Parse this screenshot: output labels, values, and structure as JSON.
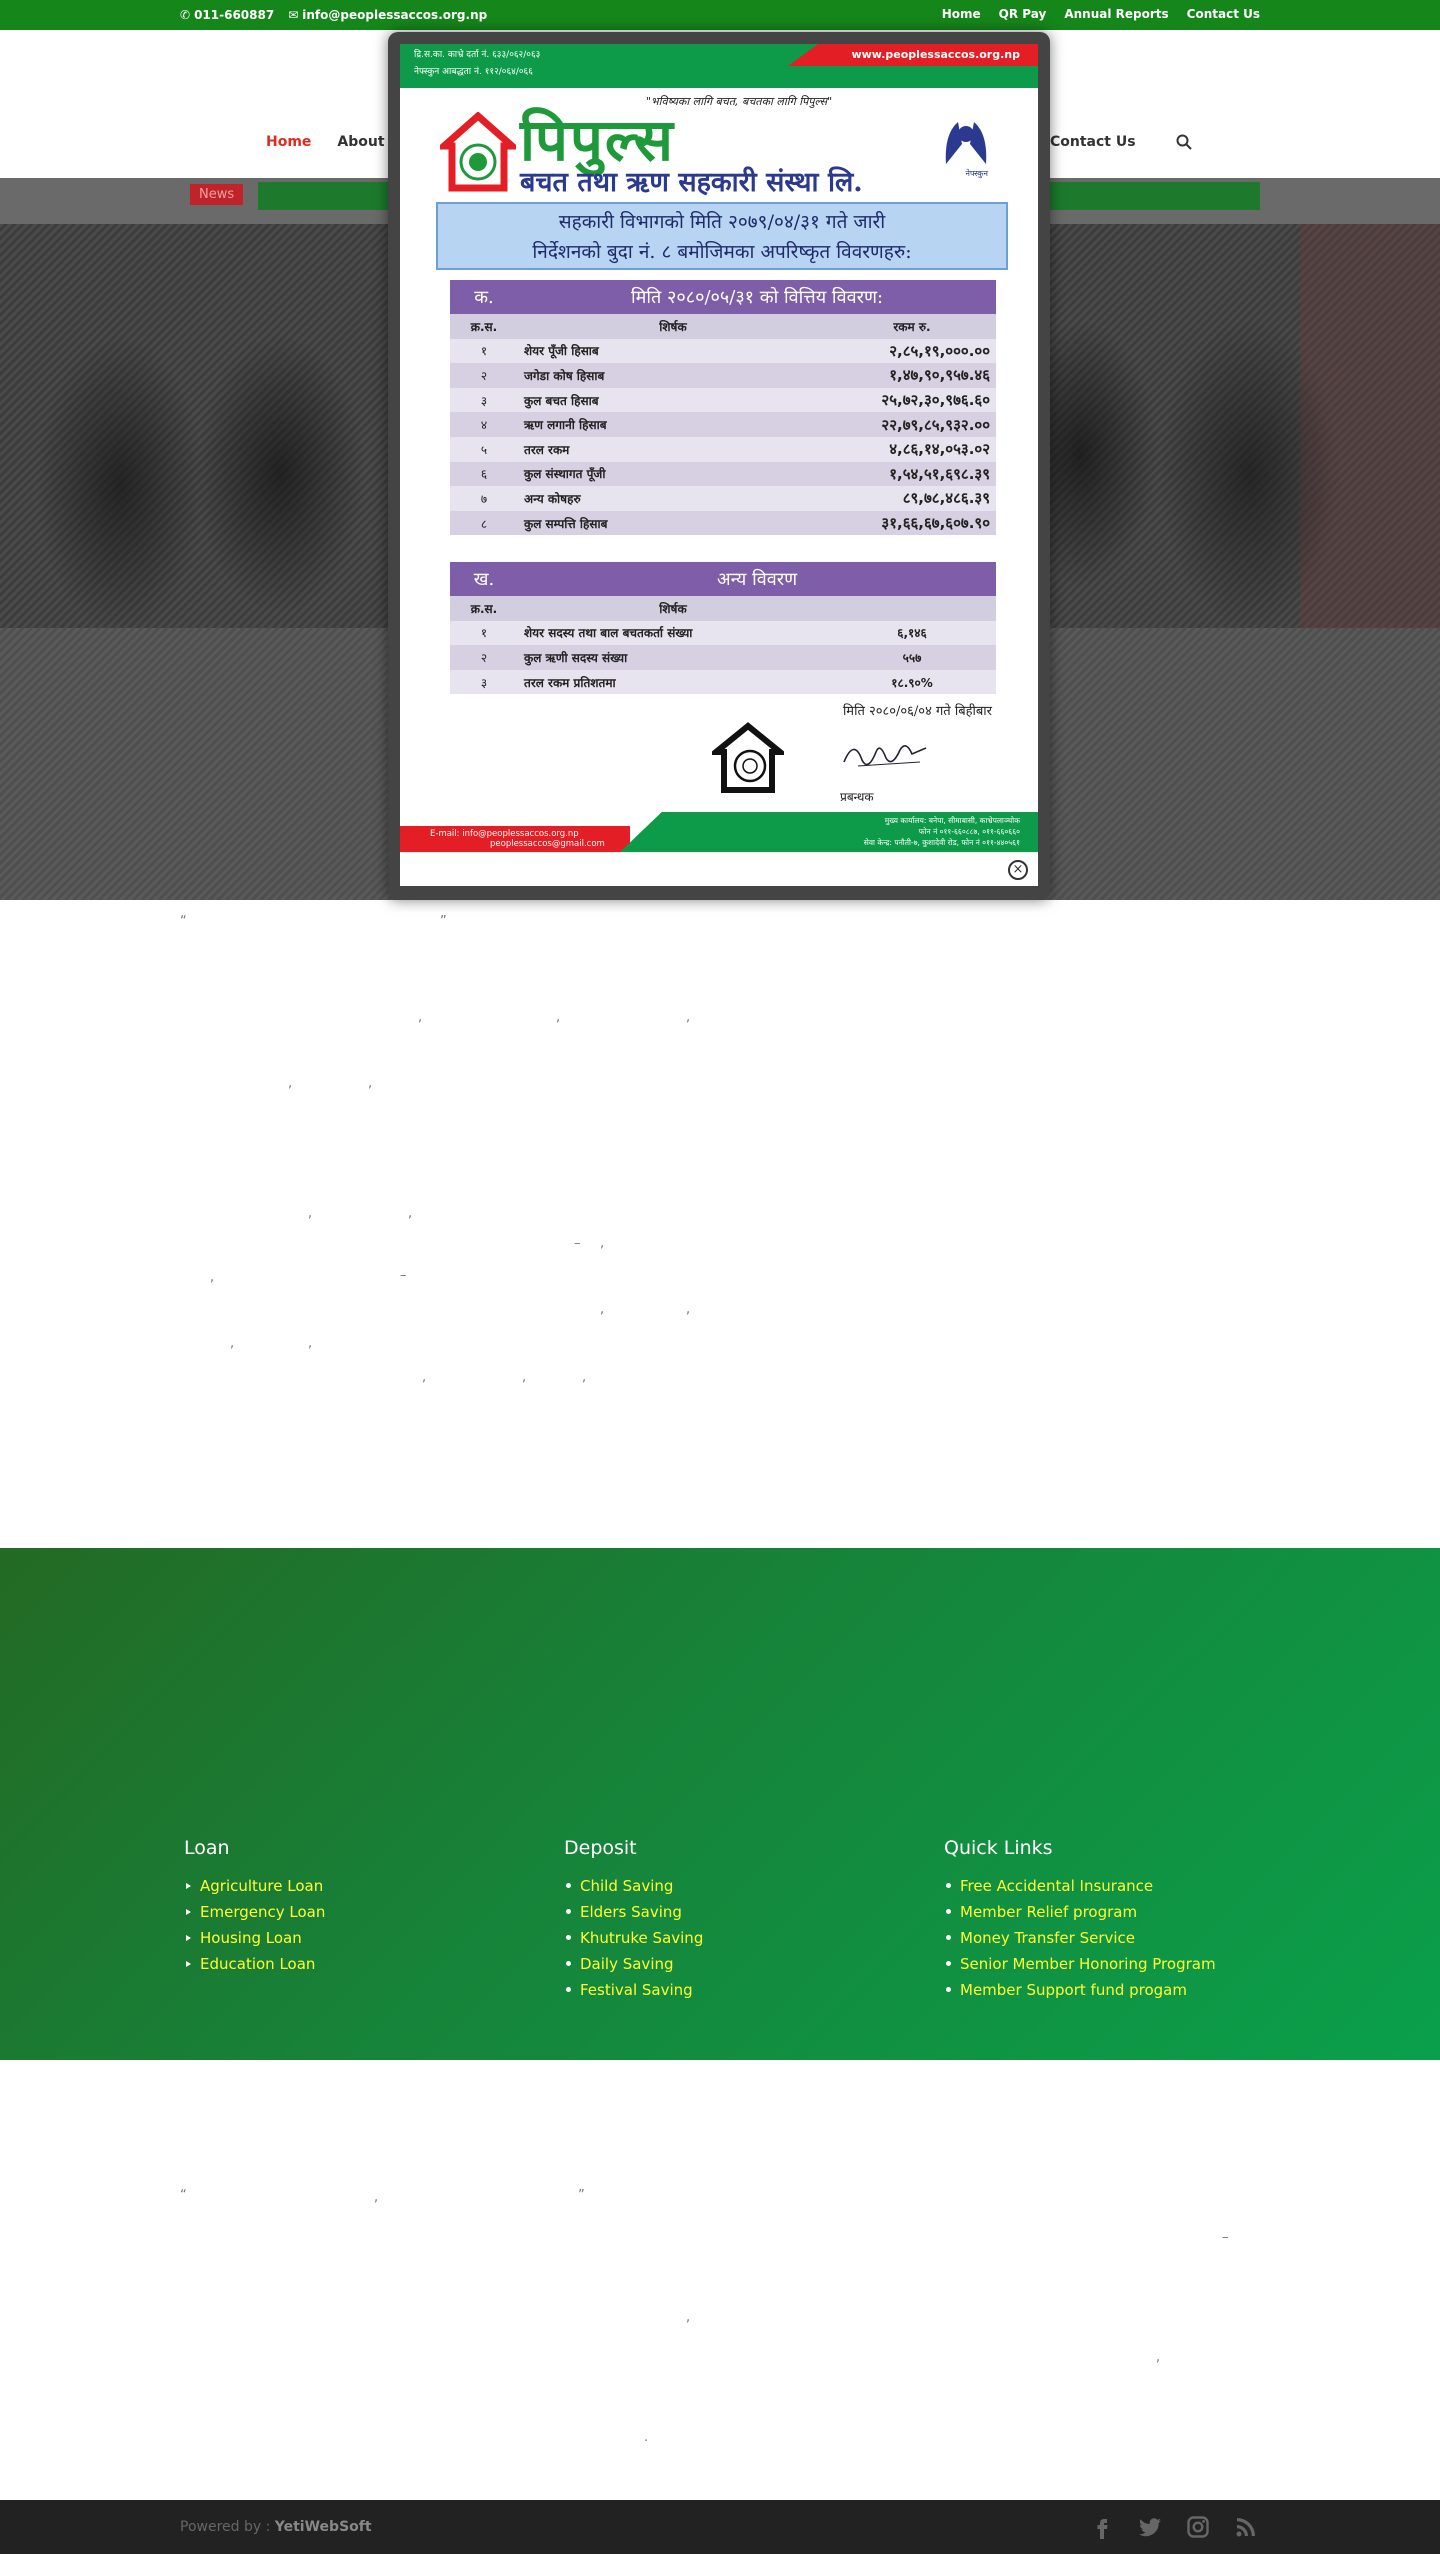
{
  "topbar": {
    "phone": "011-660887",
    "email": "info@peoplessaccos.org.np",
    "links": [
      "Home",
      "QR Pay",
      "Annual Reports",
      "Contact Us"
    ]
  },
  "nav": {
    "items": [
      "Home",
      "About"
    ],
    "right_item": "Contact Us"
  },
  "ticker": {
    "tag": "News"
  },
  "popup": {
    "reg_line1": "द्रि.स.का. काभ्रे दर्ता नं. ६३३/०६२/०६३",
    "reg_line2": "नेफ्स्कुन आबद्धता नं. ११२/०६४/०६६",
    "url": "www.peoplessaccos.org.np",
    "slogan": "\"भविष्यका लागि बचत, बचतका लागि पिपुल्स\"",
    "brand": "पिपुल्स",
    "brand_sub": "बचत तथा ऋण सहकारी संस्था लि.",
    "hands_label": "नेफ्स्कुन",
    "notice_line1": "सहकारी विभागको मिति २०७९/०४/३१ गते जारी",
    "notice_line2": "निर्देशनको बुदा नं. ८ बमोजिमका अपरिष्कृत विवरणहरु:",
    "table1": {
      "code": "क.",
      "title": "मिति २०८०/०५/३१ को वित्तिय विवरण:",
      "headers": [
        "क्र.स.",
        "शिर्षक",
        "रकम रु."
      ],
      "rows": [
        [
          "१",
          "शेयर पूँजी हिसाब",
          "२,८५,१९,०००.००"
        ],
        [
          "२",
          "जगेडा कोष हिसाब",
          "१,४७,९०,९५७.४६"
        ],
        [
          "३",
          "कुल बचत हिसाब",
          "२५,७२,३०,९७६.६०"
        ],
        [
          "४",
          "ऋण लगानी हिसाब",
          "२२,७९,८५,९३२.००"
        ],
        [
          "५",
          "तरल रकम",
          "४,८६,१४,०५३.०२"
        ],
        [
          "६",
          "कुल संस्थागत पूँजी",
          "१,५४,५१,६९८.३९"
        ],
        [
          "७",
          "अन्य कोषहरु",
          "८९,७८,४८६.३९"
        ],
        [
          "८",
          "कुल सम्पत्ति हिसाब",
          "३१,६६,६७,६०७.९०"
        ]
      ]
    },
    "table2": {
      "code": "ख.",
      "title": "अन्य विवरण",
      "headers": [
        "क्र.स.",
        "शिर्षक",
        ""
      ],
      "rows": [
        [
          "१",
          "शेयर सदस्य तथा बाल बचतकर्ता संख्या",
          "६,१४६"
        ],
        [
          "२",
          "कुल ऋणी सदस्य संख्या",
          "५५७"
        ],
        [
          "३",
          "तरल रकम प्रतिशतमा",
          "१८.९०%"
        ]
      ]
    },
    "date_line": "मिति २०८०/०६/०४ गते बिहीबार",
    "manager": "प्रबन्धक",
    "email_line1": "E-mail: info@peoplessaccos.org.np",
    "email_line2": "peoplessaccos@gmail.com",
    "addr_line1": "मुख्य कार्यालय: बनेपा, सीमाबासी, काभ्रेपलाञ्चोक",
    "addr_line2": "फोन नं ०११-६६०८८७, ०११-६६०६६०",
    "addr_line3": "सेवा केन्द्र: पनौती-७, कुशादेवी रोड, फोन नं ०११-४४०५६१",
    "close": "×"
  },
  "footer": {
    "columns": [
      {
        "title": "Loan",
        "items": [
          "Agriculture Loan",
          "Emergency Loan",
          "Housing Loan",
          "Education Loan"
        ]
      },
      {
        "title": "Deposit",
        "items": [
          "Child Saving",
          "Elders Saving",
          "Khutruke Saving",
          "Daily Saving",
          "Festival Saving"
        ]
      },
      {
        "title": "Quick Links",
        "items": [
          "Free Accidental Insurance",
          "Member Relief program",
          "Money Transfer Service",
          "Senior Member Honoring Program",
          "Member Support fund progam"
        ]
      }
    ],
    "powered_prefix": "Powered by : ",
    "powered_brand": "YetiWebSoft"
  },
  "colors": {
    "topbar": "#15861a",
    "nav_active": "#e02b20",
    "footer_link": "#ffff33",
    "bottom_bar": "#222222"
  },
  "icons": [
    "phone-icon",
    "envelope-icon",
    "chevron-down-icon",
    "search-icon",
    "close-icon",
    "facebook-icon",
    "twitter-icon",
    "instagram-icon",
    "rss-icon"
  ]
}
